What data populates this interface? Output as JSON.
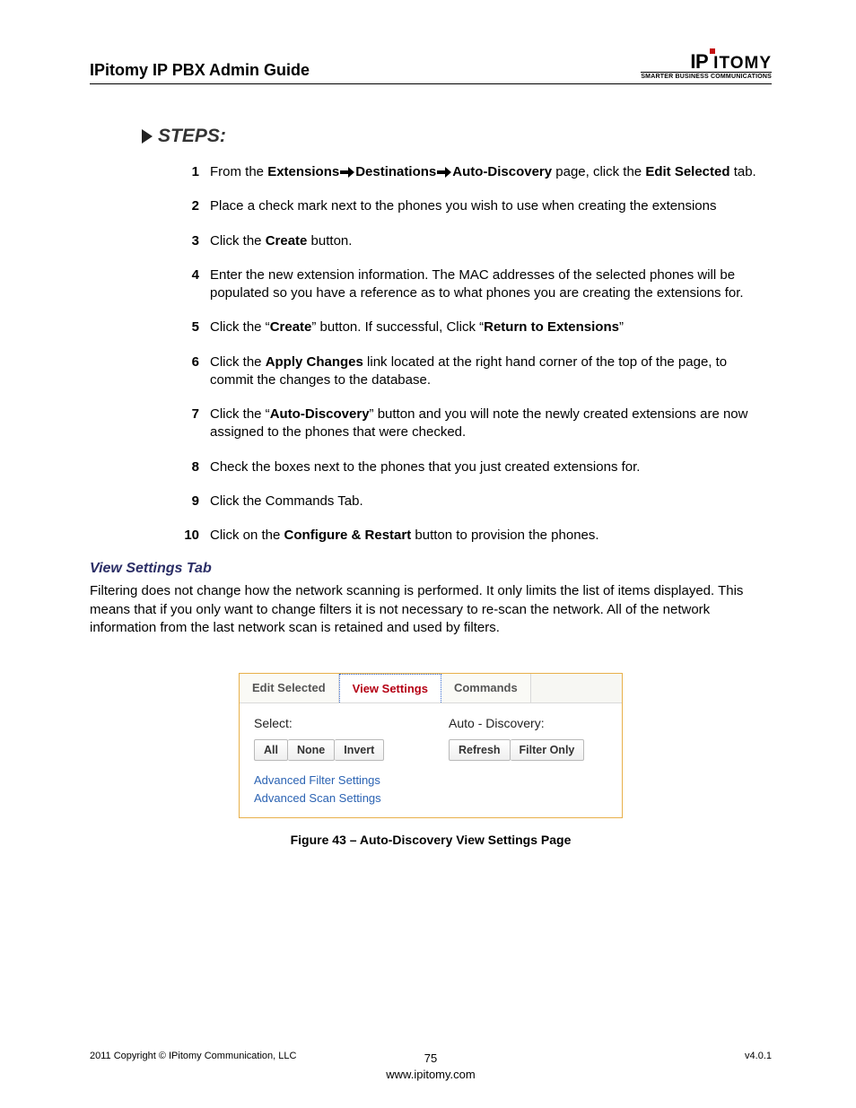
{
  "header": {
    "title": "IPitomy IP PBX Admin Guide",
    "logo_text": "IPITOMY",
    "logo_tagline": "SMARTER BUSINESS COMMUNICATIONS"
  },
  "steps_heading": "STEPS:",
  "steps": [
    {
      "num": "1",
      "parts": [
        "From the ",
        "Extensions",
        "➔",
        "Destinations",
        "➔",
        "Auto-Discovery",
        " page, click the ",
        "Edit Selected",
        " tab."
      ],
      "bold_idx": [
        1,
        3,
        5,
        7
      ]
    },
    {
      "num": "2",
      "parts": [
        "Place a check mark next to the phones you wish to use when creating the extensions"
      ],
      "bold_idx": []
    },
    {
      "num": "3",
      "parts": [
        "Click the ",
        "Create",
        " button."
      ],
      "bold_idx": [
        1
      ]
    },
    {
      "num": "4",
      "parts": [
        "Enter the new extension information. The MAC addresses of the selected phones will be populated so you have a reference as to what phones you are creating the extensions for."
      ],
      "bold_idx": []
    },
    {
      "num": "5",
      "parts": [
        "Click the “",
        "Create",
        "” button. If successful, Click “",
        "Return to Extensions",
        "”"
      ],
      "bold_idx": [
        1,
        3
      ]
    },
    {
      "num": "6",
      "parts": [
        "Click the ",
        "Apply Changes",
        " link located at the right hand corner of the top of the page, to commit the changes to the database."
      ],
      "bold_idx": [
        1
      ]
    },
    {
      "num": "7",
      "parts": [
        "Click the “",
        "Auto-Discovery",
        "” button and you will note the newly created extensions are now assigned to the phones that were checked."
      ],
      "bold_idx": [
        1
      ]
    },
    {
      "num": "8",
      "parts": [
        "Check the boxes next to the phones that you just created extensions for."
      ],
      "bold_idx": []
    },
    {
      "num": "9",
      "parts": [
        "Click the Commands Tab."
      ],
      "bold_idx": []
    },
    {
      "num": "10",
      "parts": [
        "Click on the ",
        "Configure & Restart",
        " button to provision the phones."
      ],
      "bold_idx": [
        1
      ]
    }
  ],
  "section": {
    "heading": "View Settings Tab",
    "para": "Filtering does not change how the network scanning is performed. It only limits the list of items displayed. This means that if you only want to change filters it is not necessary to re-scan the network. All of the network information from the last network scan is retained and used by filters."
  },
  "ui": {
    "tabs": [
      "Edit Selected",
      "View Settings",
      "Commands"
    ],
    "active_tab_index": 1,
    "left_label": "Select:",
    "right_label": "Auto - Discovery:",
    "left_buttons": [
      "All",
      "None",
      "Invert"
    ],
    "right_buttons": [
      "Refresh",
      "Filter Only"
    ],
    "links": [
      "Advanced Filter Settings",
      "Advanced Scan Settings"
    ]
  },
  "figure_caption": "Figure 43 – Auto-Discovery View Settings Page",
  "footer": {
    "left": "2011 Copyright © IPitomy Communication, LLC",
    "page_num": "75",
    "url": "www.ipitomy.com",
    "right": "v4.0.1"
  }
}
